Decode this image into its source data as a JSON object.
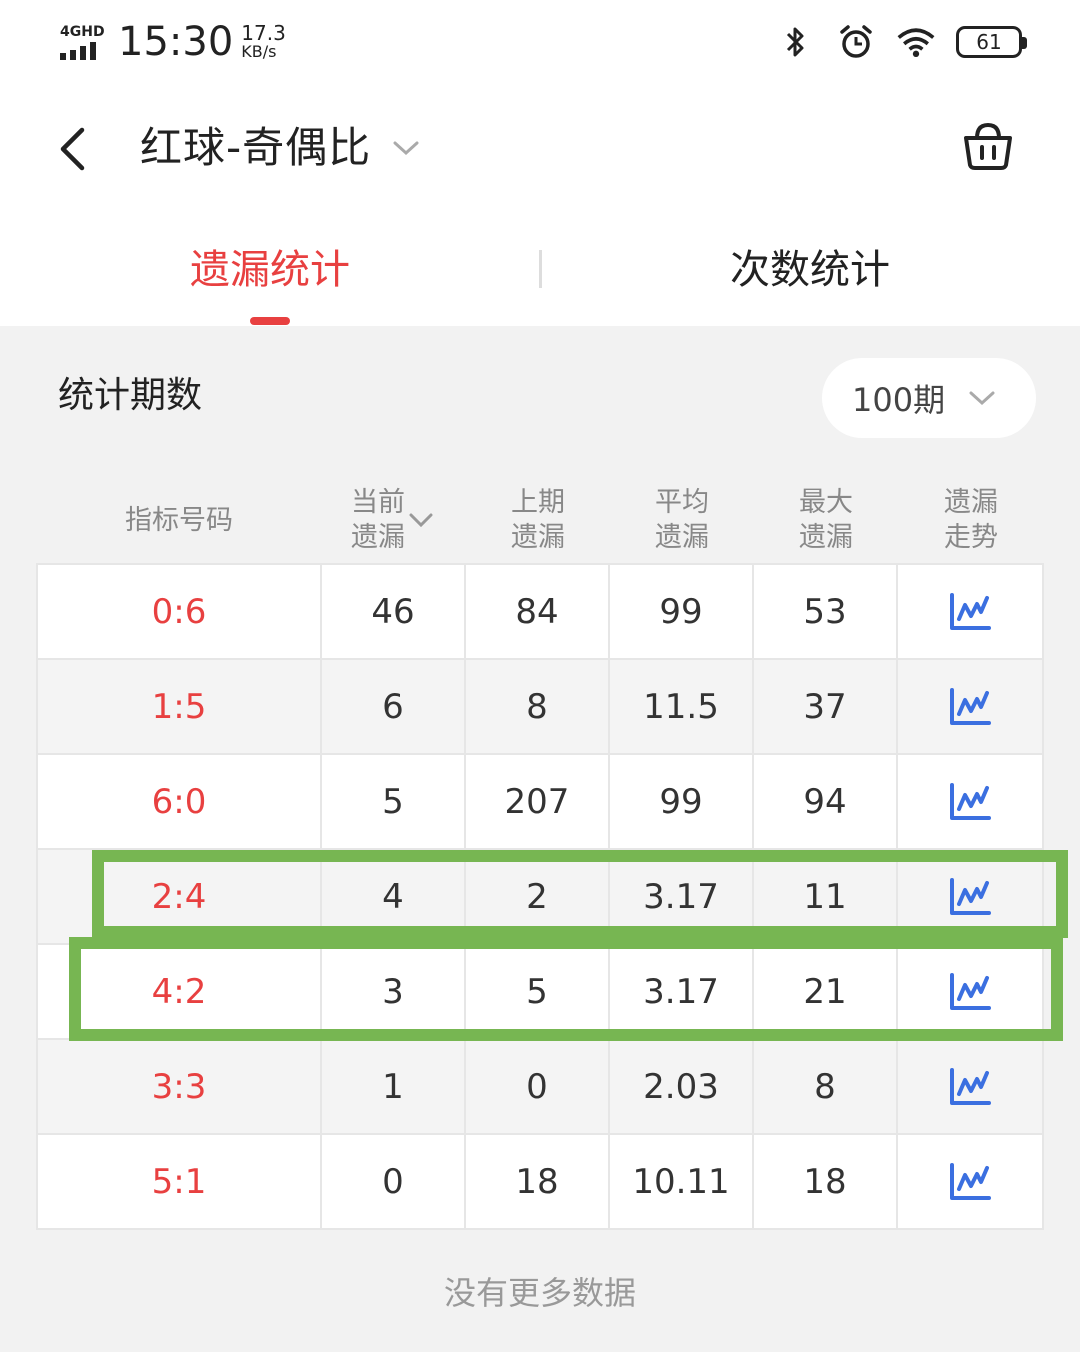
{
  "status_bar": {
    "network": "4GHD",
    "time": "15:30",
    "speed_value": "17.3",
    "speed_unit": "KB/s",
    "battery": "61",
    "icons": [
      "bluetooth-icon",
      "alarm-icon",
      "wifi-icon",
      "battery-icon"
    ]
  },
  "header": {
    "title": "红球-奇偶比",
    "back_icon": "chevron-left-icon",
    "dropdown_icon": "chevron-down-icon",
    "cart_icon": "basket-icon"
  },
  "tabs": [
    {
      "label": "遗漏统计",
      "active": true
    },
    {
      "label": "次数统计",
      "active": false
    }
  ],
  "period": {
    "label": "统计期数",
    "value": "100期"
  },
  "table": {
    "headers": [
      {
        "line1": "指标号码",
        "line2": ""
      },
      {
        "line1": "当前",
        "line2": "遗漏",
        "sortable": true
      },
      {
        "line1": "上期",
        "line2": "遗漏"
      },
      {
        "line1": "平均",
        "line2": "遗漏"
      },
      {
        "line1": "最大",
        "line2": "遗漏"
      },
      {
        "line1": "遗漏",
        "line2": "走势"
      }
    ],
    "rows": [
      {
        "code": "0:6",
        "current": "46",
        "last": "84",
        "avg": "99",
        "max": "53"
      },
      {
        "code": "1:5",
        "current": "6",
        "last": "8",
        "avg": "11.5",
        "max": "37"
      },
      {
        "code": "6:0",
        "current": "5",
        "last": "207",
        "avg": "99",
        "max": "94"
      },
      {
        "code": "2:4",
        "current": "4",
        "last": "2",
        "avg": "3.17",
        "max": "11"
      },
      {
        "code": "4:2",
        "current": "3",
        "last": "5",
        "avg": "3.17",
        "max": "21"
      },
      {
        "code": "3:3",
        "current": "1",
        "last": "0",
        "avg": "2.03",
        "max": "8"
      },
      {
        "code": "5:1",
        "current": "0",
        "last": "18",
        "avg": "10.11",
        "max": "18"
      }
    ],
    "trend_icon": "line-chart-icon"
  },
  "footer_text": "没有更多数据",
  "colors": {
    "accent": "#e84040",
    "trend_icon": "#3b6fe0",
    "highlight": "#77b652"
  }
}
